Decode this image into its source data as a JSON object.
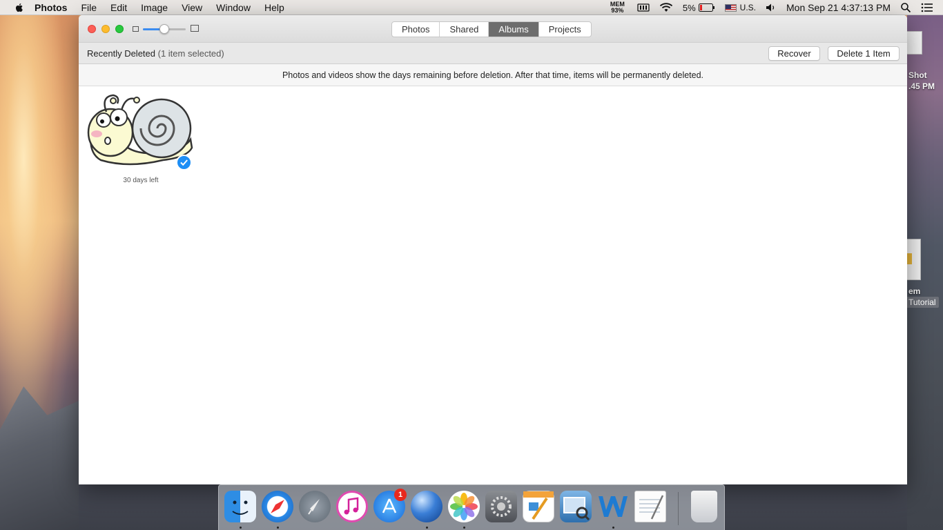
{
  "menubar": {
    "app_name": "Photos",
    "items": [
      "File",
      "Edit",
      "Image",
      "View",
      "Window",
      "Help"
    ],
    "status": {
      "mem_label": "MEM",
      "mem_value": "93%",
      "battery": "5%",
      "input_source": "U.S.",
      "datetime": "Mon Sep 21  4:37:13 PM"
    }
  },
  "desktop": {
    "icon1_label_line1": "Shot",
    "icon1_label_line2": ".45 PM",
    "icon2_label_line1": "em",
    "icon2_label_line2": "Tutorial"
  },
  "window": {
    "tabs": [
      "Photos",
      "Shared",
      "Albums",
      "Projects"
    ],
    "active_tab": "Albums",
    "zoom_level": 0.5,
    "album_title": "Recently Deleted",
    "selection_text": "(1 item selected)",
    "recover_label": "Recover",
    "delete_label": "Delete 1 Item",
    "info_text": "Photos and videos show the days remaining before deletion. After that time, items will be permanently deleted.",
    "items": [
      {
        "caption": "30 days left",
        "selected": true
      }
    ]
  },
  "dock": {
    "apps": [
      "Finder",
      "Safari",
      "Launchpad",
      "iTunes",
      "App Store",
      "Camino",
      "Photos",
      "System Preferences",
      "Pages",
      "Preview",
      "Word",
      "TextEdit",
      "Trash"
    ],
    "app_store_badge": "1"
  }
}
